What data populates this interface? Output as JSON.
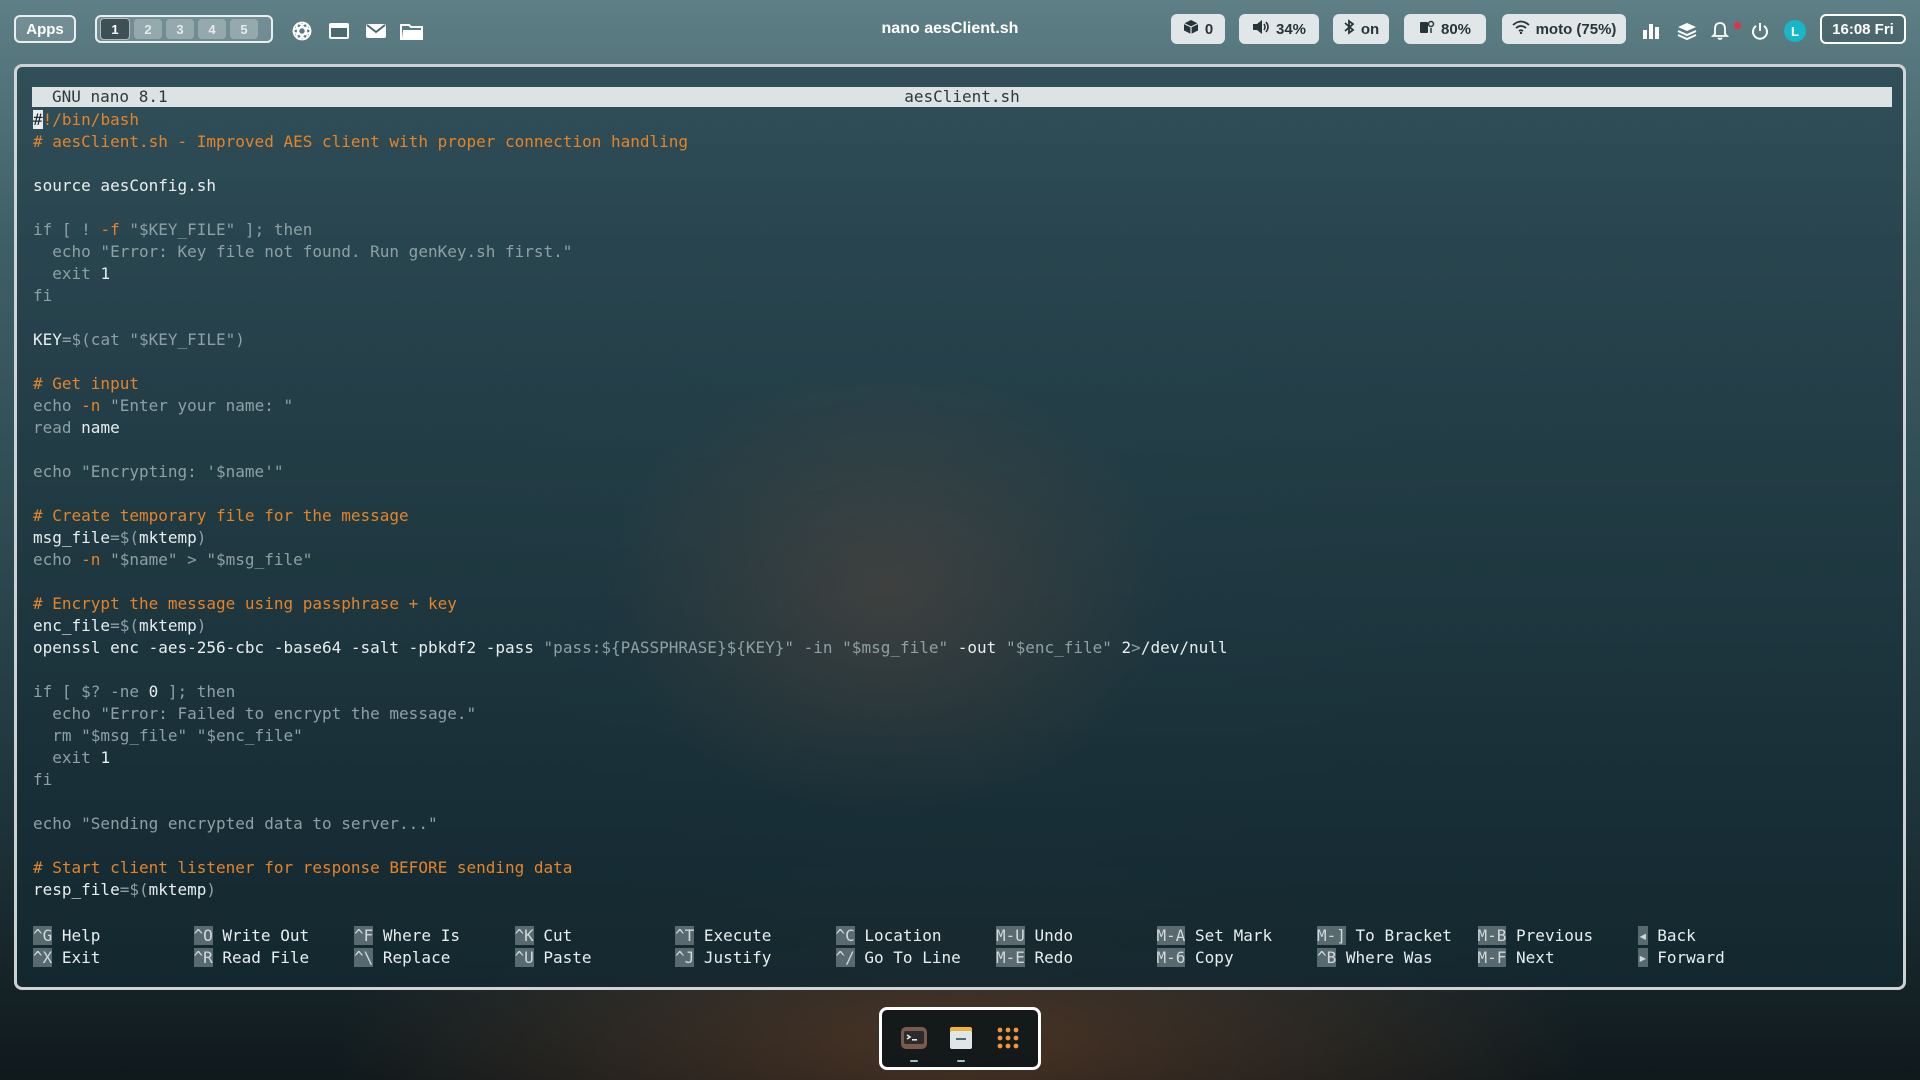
{
  "topbar": {
    "apps_label": "Apps",
    "workspaces": [
      "1",
      "2",
      "3",
      "4",
      "5"
    ],
    "active_workspace": "1",
    "launchers": [
      "chatgpt-icon",
      "window-icon",
      "mail-icon",
      "folder-icon"
    ],
    "window_title": "nano aesClient.sh",
    "updates": {
      "icon": "package-icon",
      "value": "0"
    },
    "volume": {
      "icon": "speaker-icon",
      "value": "34%"
    },
    "bluetooth": {
      "icon": "bluetooth-icon",
      "value": "on"
    },
    "brightness": {
      "icon": "brightness-icon",
      "value": "80%"
    },
    "wifi": {
      "icon": "wifi-icon",
      "value": "moto (75%)"
    },
    "tray_icons": [
      "stats-icon",
      "layers-icon",
      "bell-icon",
      "power-icon",
      "avatar"
    ],
    "avatar_letter": "L",
    "clock": "16:08 Fri",
    "colors": {
      "accent": "#17b7c7",
      "notification": "#e0304a"
    }
  },
  "nano": {
    "version": "GNU nano 8.1",
    "filename": "aesClient.sh",
    "lines": [
      [
        {
          "t": "#",
          "s": "cursor"
        },
        {
          "t": "!/bin/bash",
          "s": "c"
        }
      ],
      [
        {
          "t": "# aesClient.sh - Improved AES client with proper connection handling",
          "s": "c"
        }
      ],
      [],
      [
        {
          "t": "source aesConfig.sh",
          "s": "w"
        }
      ],
      [],
      [
        {
          "t": "if [ ! ",
          "s": "d"
        },
        {
          "t": "-f",
          "s": "c"
        },
        {
          "t": " \"$KEY_FILE\" ]; then",
          "s": "d"
        }
      ],
      [
        {
          "t": "  echo \"Error: Key file not found. Run genKey.sh first.\"",
          "s": "d"
        }
      ],
      [
        {
          "t": "  exit ",
          "s": "d"
        },
        {
          "t": "1",
          "s": "w"
        }
      ],
      [
        {
          "t": "fi",
          "s": "d"
        }
      ],
      [],
      [
        {
          "t": "KEY",
          "s": "w"
        },
        {
          "t": "=$(cat \"$KEY_FILE\")",
          "s": "d"
        }
      ],
      [],
      [
        {
          "t": "# Get input",
          "s": "c"
        }
      ],
      [
        {
          "t": "echo ",
          "s": "d"
        },
        {
          "t": "-n",
          "s": "c"
        },
        {
          "t": " \"Enter your name: \"",
          "s": "d"
        }
      ],
      [
        {
          "t": "read ",
          "s": "d"
        },
        {
          "t": "name",
          "s": "w"
        }
      ],
      [],
      [
        {
          "t": "echo \"Encrypting: '$name'\"",
          "s": "d"
        }
      ],
      [],
      [
        {
          "t": "# Create temporary file for the message",
          "s": "c"
        }
      ],
      [
        {
          "t": "msg_file",
          "s": "w"
        },
        {
          "t": "=$(",
          "s": "d"
        },
        {
          "t": "mktemp",
          "s": "w"
        },
        {
          "t": ")",
          "s": "d"
        }
      ],
      [
        {
          "t": "echo ",
          "s": "d"
        },
        {
          "t": "-n",
          "s": "c"
        },
        {
          "t": " \"$name\" > \"$msg_file\"",
          "s": "d"
        }
      ],
      [],
      [
        {
          "t": "# Encrypt the message using passphrase + key",
          "s": "c"
        }
      ],
      [
        {
          "t": "enc_file",
          "s": "w"
        },
        {
          "t": "=$(",
          "s": "d"
        },
        {
          "t": "mktemp",
          "s": "w"
        },
        {
          "t": ")",
          "s": "d"
        }
      ],
      [
        {
          "t": "openssl enc -aes-256-cbc -base64 -salt -pbkdf2 -pass ",
          "s": "w"
        },
        {
          "t": "\"pass:${PASSPHRASE}${KEY}\"",
          "s": "d"
        },
        {
          "t": " -in ",
          "s": "d"
        },
        {
          "t": "\"$msg_file\"",
          "s": "d"
        },
        {
          "t": " -out ",
          "s": "w"
        },
        {
          "t": "\"$enc_file\"",
          "s": "d"
        },
        {
          "t": " 2",
          "s": "w"
        },
        {
          "t": ">",
          "s": "d"
        },
        {
          "t": "/dev/null",
          "s": "w"
        }
      ],
      [],
      [
        {
          "t": "if [ $? -ne ",
          "s": "d"
        },
        {
          "t": "0",
          "s": "w"
        },
        {
          "t": " ]; then",
          "s": "d"
        }
      ],
      [
        {
          "t": "  echo \"Error: Failed to encrypt the message.\"",
          "s": "d"
        }
      ],
      [
        {
          "t": "  rm \"$msg_file\" \"$enc_file\"",
          "s": "d"
        }
      ],
      [
        {
          "t": "  exit ",
          "s": "d"
        },
        {
          "t": "1",
          "s": "w"
        }
      ],
      [
        {
          "t": "fi",
          "s": "d"
        }
      ],
      [],
      [
        {
          "t": "echo \"Sending encrypted data to server...\"",
          "s": "d"
        }
      ],
      [],
      [
        {
          "t": "# Start client listener for response BEFORE sending data",
          "s": "c"
        }
      ],
      [
        {
          "t": "resp_file",
          "s": "w"
        },
        {
          "t": "=$(",
          "s": "d"
        },
        {
          "t": "mktemp",
          "s": "w"
        },
        {
          "t": ")",
          "s": "d"
        }
      ]
    ],
    "shortcuts": [
      [
        {
          "key": "^G",
          "label": "Help"
        },
        {
          "key": "^X",
          "label": "Exit"
        }
      ],
      [
        {
          "key": "^O",
          "label": "Write Out"
        },
        {
          "key": "^R",
          "label": "Read File"
        }
      ],
      [
        {
          "key": "^F",
          "label": "Where Is"
        },
        {
          "key": "^\\",
          "label": "Replace"
        }
      ],
      [
        {
          "key": "^K",
          "label": "Cut"
        },
        {
          "key": "^U",
          "label": "Paste"
        }
      ],
      [
        {
          "key": "^T",
          "label": "Execute"
        },
        {
          "key": "^J",
          "label": "Justify"
        }
      ],
      [
        {
          "key": "^C",
          "label": "Location"
        },
        {
          "key": "^/",
          "label": "Go To Line"
        }
      ],
      [
        {
          "key": "M-U",
          "label": "Undo"
        },
        {
          "key": "M-E",
          "label": "Redo"
        }
      ],
      [
        {
          "key": "M-A",
          "label": "Set Mark"
        },
        {
          "key": "M-6",
          "label": "Copy"
        }
      ],
      [
        {
          "key": "M-]",
          "label": "To Bracket"
        },
        {
          "key": "^B",
          "label": "Where Was"
        }
      ],
      [
        {
          "key": "M-B",
          "label": "Previous"
        },
        {
          "key": "M-F",
          "label": "Next"
        }
      ],
      [
        {
          "key": "◂",
          "label": "Back"
        },
        {
          "key": "▸",
          "label": "Forward"
        }
      ]
    ]
  },
  "dock": {
    "items": [
      "terminal-icon",
      "files-icon",
      "app-grid-icon"
    ]
  }
}
